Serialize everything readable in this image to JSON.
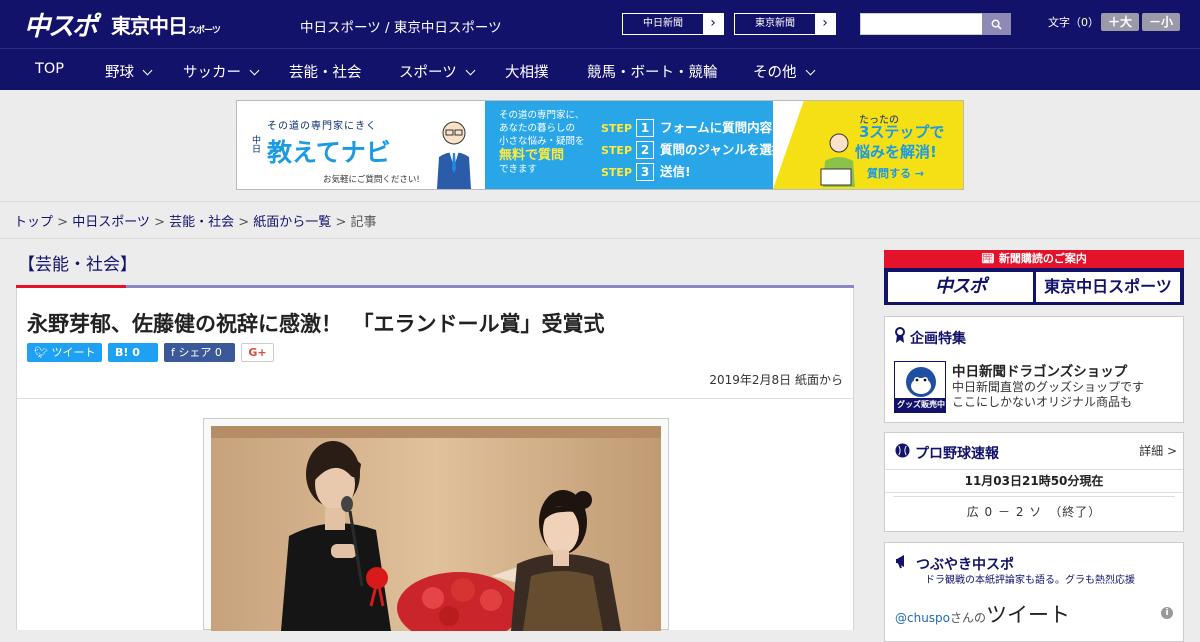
{
  "header": {
    "logo_chuspo": "中スポ",
    "logo_tokyo": "東京中日",
    "logo_tokyo_sub": "スポーツ",
    "site_link": "中日スポーツ / 東京中日スポーツ",
    "paper_buttons": [
      "中日新聞",
      "東京新聞"
    ],
    "font_size_label": "文字（0）",
    "font_up": "＋大",
    "font_down": "－小"
  },
  "nav": {
    "items": [
      "TOP",
      "野球",
      "サッカー",
      "芸能・社会",
      "スポーツ",
      "大相撲",
      "競馬・ボート・競輪",
      "その他"
    ]
  },
  "banner": {
    "line1": "その道の専門家にきく",
    "brand_prefix": "中日",
    "brand": "教えてナビ",
    "tagline": "お気軽にご質問ください!",
    "mid_lines": [
      "その道の専門家に、",
      "あなたの暮らしの",
      "小さな悩み・疑問を"
    ],
    "mid_highlight": "無料で質問",
    "mid_end": "できます",
    "step_word": "STEP",
    "steps": [
      {
        "num": "1",
        "text": "フォームに質問内容を入力"
      },
      {
        "num": "2",
        "text": "質問のジャンルを選択"
      },
      {
        "num": "3",
        "text": "送信!"
      }
    ],
    "right_small": "たったの",
    "right_big1": "3ステップで",
    "right_big2": "悩みを解消!",
    "right_cta": "質問する →"
  },
  "breadcrumb": {
    "items": [
      "トップ",
      "中日スポーツ",
      "芸能・社会",
      "紙面から一覧"
    ],
    "current": "記事"
  },
  "article": {
    "category": "【芸能・社会】",
    "headline": "永野芽郁、佐藤健の祝辞に感激！　「エランドール賞」受賞式",
    "share_tweet": "ツイート",
    "share_hatena": "B! 0",
    "share_facebook": "f シェア 0",
    "share_gplus": "G+",
    "date": "2019年2月8日 紙面から"
  },
  "sidebar": {
    "subscribe_title": "新聞購読のご案内",
    "subscribe_a": "中スポ",
    "subscribe_b": "東京中日スポーツ",
    "feature_title": "企画特集",
    "shop_badge": "グッズ販売中",
    "shop_name": "中日新聞ドラゴンズショップ",
    "shop_desc1": "中日新聞直営のグッズショップです",
    "shop_desc2": "ここにしかないオリジナル商品も",
    "baseball_title": "プロ野球速報",
    "baseball_more": "詳細 >",
    "baseball_time": "11月03日21時50分現在",
    "baseball_score": "広 0 － 2 ソ　（終了）",
    "tweet_title": "つぶやき中スポ",
    "tweet_sub": "ドラ観戦の本紙評論家も語る。グラも熱烈応援",
    "tweet_handle": "@chuspo",
    "tweet_san": "さんの",
    "tweet_word": "ツイート"
  },
  "colors": {
    "navy": "#13126b",
    "red": "#e4122a",
    "lavender": "#8b86c5"
  }
}
